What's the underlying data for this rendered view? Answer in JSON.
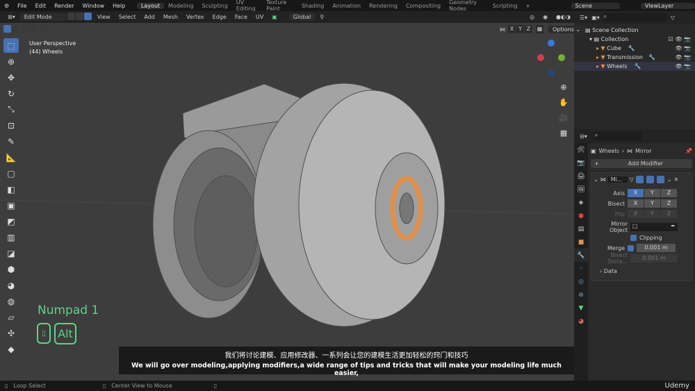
{
  "menu": [
    "File",
    "Edit",
    "Render",
    "Window",
    "Help"
  ],
  "workspaces": [
    "Layout",
    "Modeling",
    "Sculpting",
    "UV Editing",
    "Texture Paint",
    "Shading",
    "Animation",
    "Rendering",
    "Compositing",
    "Geometry Nodes",
    "Scripting"
  ],
  "active_workspace": "Layout",
  "scene": "Scene",
  "view_layer": "ViewLayer",
  "header": {
    "mode": "Edit Mode",
    "menus": [
      "View",
      "Select",
      "Add",
      "Mesh",
      "Vertex",
      "Edge",
      "Face",
      "UV"
    ],
    "transform": "Global",
    "axes": [
      "X",
      "Y",
      "Z"
    ],
    "options": "Options"
  },
  "viewport": {
    "view_name": "User Perspective",
    "object": "(44) Wheels",
    "key_hint": "Numpad 1",
    "key_badge": "Alt",
    "subtitle_cn": "我们将讨论建模、应用修改器、一系列会让您的建模生活更加轻松的窍门和技巧",
    "subtitle_en": "We will go over modeling,applying modifiers,a wide range of tips and tricks that will make your modeling life much easier,"
  },
  "outliner": {
    "root": "Scene Collection",
    "collection": "Collection",
    "objects": [
      "Cube",
      "Transmission",
      "Wheels"
    ]
  },
  "properties": {
    "breadcrumb_object": "Wheels",
    "breadcrumb_modifier": "Mirror",
    "add_modifier": "Add Modifier",
    "modifier_name": "Mi...",
    "axis_label": "Axis",
    "bisect_label": "Bisect",
    "flip_label": "Flip",
    "axes": [
      "X",
      "Y",
      "Z"
    ],
    "mirror_object_label": "Mirror Object",
    "clipping_label": "Clipping",
    "clipping": true,
    "merge_label": "Merge",
    "merge": true,
    "merge_value": "0.001 m",
    "bisect_distance_label": "Bisect Dista...",
    "bisect_distance_value": "0.001 m",
    "data_label": "Data"
  },
  "status": {
    "left": "Loop Select",
    "middle": "Center View to Mouse"
  },
  "watermark": "Udemy",
  "colors": {
    "accent": "#4772b3",
    "key_hint": "#5fd38a",
    "selection": "#e0904a"
  }
}
